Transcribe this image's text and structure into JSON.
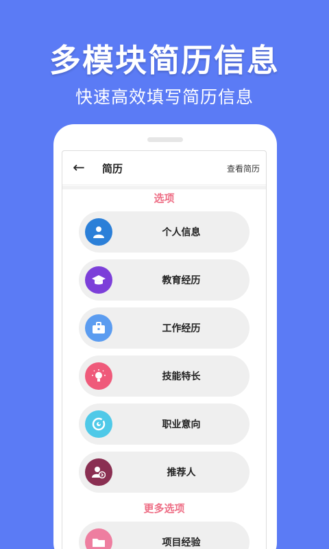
{
  "banner": {
    "headline": "多模块简历信息",
    "subline": "快速高效填写简历信息"
  },
  "appbar": {
    "back_icon": "arrow-left-icon",
    "title": "简历",
    "view_link": "查看简历"
  },
  "sections": {
    "options_title": "选项",
    "more_title": "更多选项"
  },
  "items": [
    {
      "label": "个人信息",
      "icon": "person-icon",
      "color": "#2b7fd8"
    },
    {
      "label": "教育经历",
      "icon": "graduation-cap-icon",
      "color": "#7c3fd9"
    },
    {
      "label": "工作经历",
      "icon": "briefcase-icon",
      "color": "#5b9cf0"
    },
    {
      "label": "技能特长",
      "icon": "lightbulb-icon",
      "color": "#ef5a7a"
    },
    {
      "label": "职业意向",
      "icon": "target-icon",
      "color": "#4fc9e8"
    },
    {
      "label": "推荐人",
      "icon": "user-arrow-icon",
      "color": "#8a2f52"
    },
    {
      "label": "项目经验",
      "icon": "folder-icon",
      "color": "#ee7ea0"
    }
  ],
  "colors": {
    "background": "#5b7bf5",
    "accent": "#ee6f86"
  }
}
